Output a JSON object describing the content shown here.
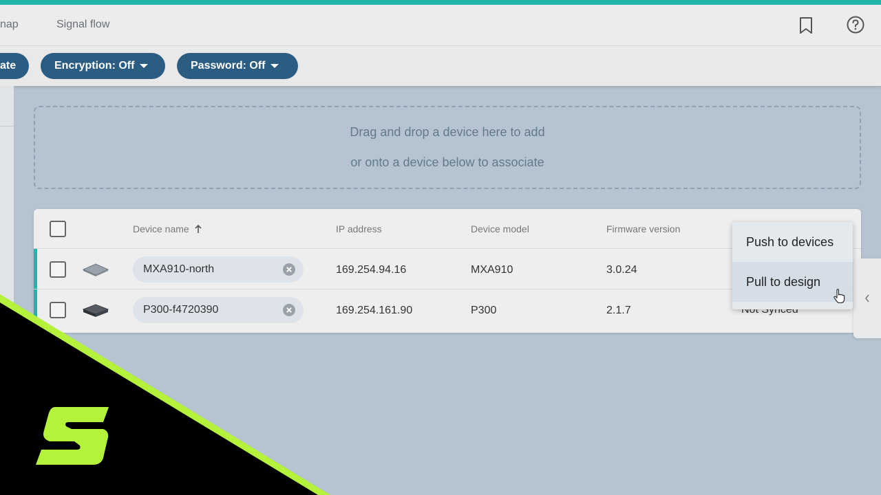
{
  "header": {
    "tabs": [
      {
        "label": "nap"
      },
      {
        "label": "Signal flow"
      }
    ]
  },
  "toolbar": {
    "pills": [
      {
        "label": "ate"
      },
      {
        "label": "Encryption: Off"
      },
      {
        "label": "Password: Off"
      }
    ]
  },
  "dropzone": {
    "line1": "Drag and drop a device here to add",
    "line2": "or onto a device below to associate"
  },
  "table": {
    "columns": {
      "device_name": "Device name",
      "ip_address": "IP address",
      "device_model": "Device model",
      "firmware_version": "Firmware version"
    },
    "sort": {
      "column": "Device name",
      "direction": "ascending"
    },
    "rows": [
      {
        "name": "MXA910-north",
        "ip": "169.254.94.16",
        "model": "MXA910",
        "firmware": "3.0.24"
      },
      {
        "name": "P300-f4720390",
        "ip": "169.254.161.90",
        "model": "P300",
        "firmware": "2.1.7",
        "status": "Not Synced"
      }
    ]
  },
  "context_menu": {
    "items": [
      {
        "label": "Push to devices"
      },
      {
        "label": "Pull to design",
        "hovered": true
      }
    ]
  },
  "colors": {
    "accent_teal": "#1fb5a8",
    "pill_blue": "#2b5d83",
    "brand_green": "#b5f23c",
    "background": "#b5c4d0"
  },
  "icons": [
    "bookmark-icon",
    "help-icon",
    "sort-up-icon",
    "clear-icon",
    "chevron-left-icon",
    "pointer-hand-icon",
    "brand-logo"
  ]
}
